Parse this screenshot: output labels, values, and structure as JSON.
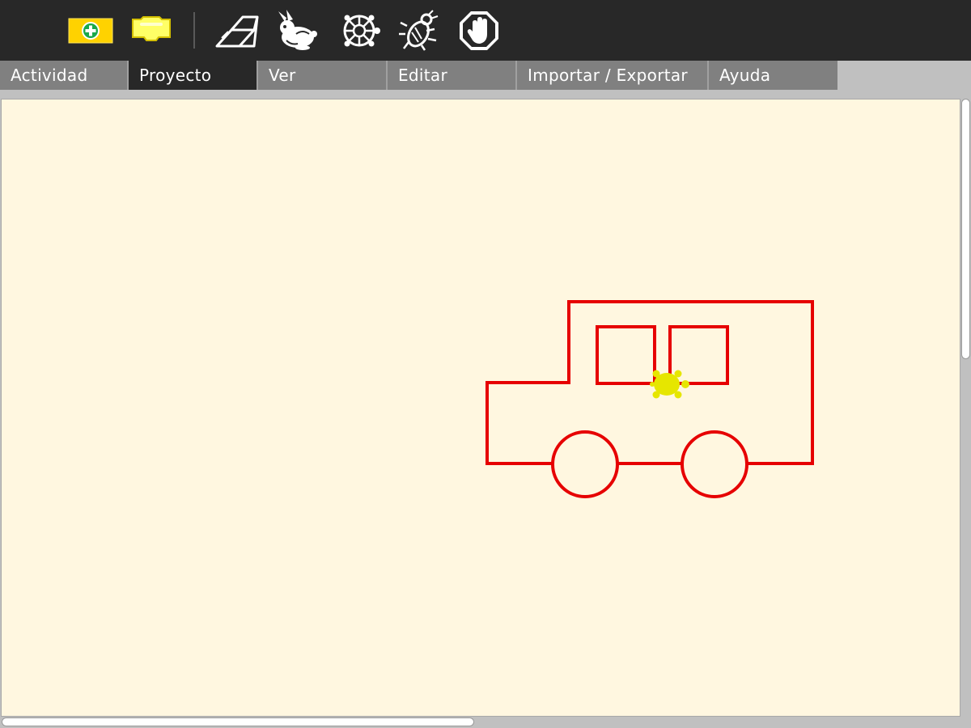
{
  "toolbar": {
    "tools": [
      {
        "icon": "new-project-icon"
      },
      {
        "icon": "block-palette-icon"
      },
      {
        "icon": "eraser-icon"
      },
      {
        "icon": "rabbit-icon"
      },
      {
        "icon": "turtle-icon"
      },
      {
        "icon": "bug-icon"
      },
      {
        "icon": "stop-hand-icon"
      }
    ]
  },
  "tabs": [
    {
      "label": "Actividad"
    },
    {
      "label": "Proyecto",
      "active": true
    },
    {
      "label": "Ver"
    },
    {
      "label": "Editar"
    },
    {
      "label": "Importar / Exportar"
    },
    {
      "label": "Ayuda"
    }
  ],
  "canvas": {
    "background": "#fff7e0",
    "pen_color": "#e60000",
    "turtle_color": "#e6e600"
  },
  "colors": {
    "toolbar_bg": "#282828",
    "tab_bg": "#808080",
    "tab_active_bg": "#282828",
    "yellow_accent": "#ffd700"
  }
}
